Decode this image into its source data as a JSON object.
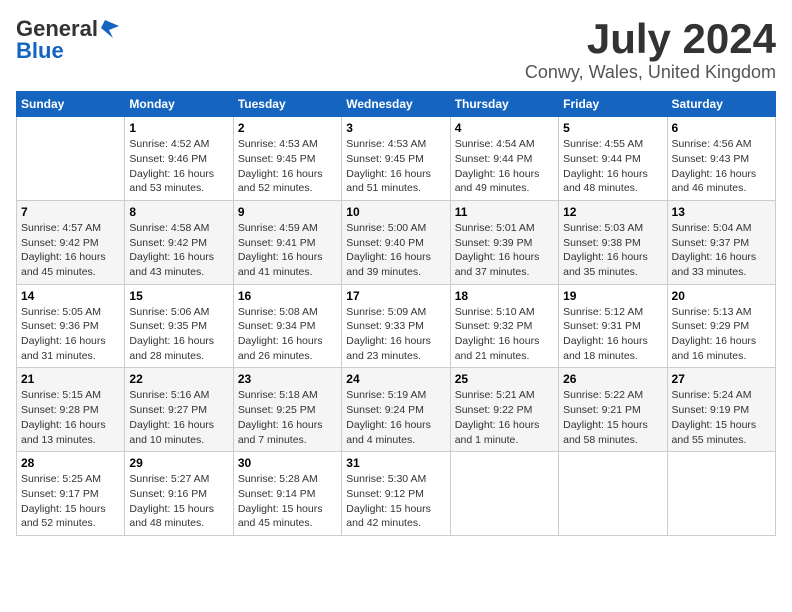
{
  "logo": {
    "general": "General",
    "blue": "Blue"
  },
  "title": {
    "month": "July 2024",
    "location": "Conwy, Wales, United Kingdom"
  },
  "weekdays": [
    "Sunday",
    "Monday",
    "Tuesday",
    "Wednesday",
    "Thursday",
    "Friday",
    "Saturday"
  ],
  "weeks": [
    [
      {
        "day": "",
        "content": ""
      },
      {
        "day": "1",
        "content": "Sunrise: 4:52 AM\nSunset: 9:46 PM\nDaylight: 16 hours\nand 53 minutes."
      },
      {
        "day": "2",
        "content": "Sunrise: 4:53 AM\nSunset: 9:45 PM\nDaylight: 16 hours\nand 52 minutes."
      },
      {
        "day": "3",
        "content": "Sunrise: 4:53 AM\nSunset: 9:45 PM\nDaylight: 16 hours\nand 51 minutes."
      },
      {
        "day": "4",
        "content": "Sunrise: 4:54 AM\nSunset: 9:44 PM\nDaylight: 16 hours\nand 49 minutes."
      },
      {
        "day": "5",
        "content": "Sunrise: 4:55 AM\nSunset: 9:44 PM\nDaylight: 16 hours\nand 48 minutes."
      },
      {
        "day": "6",
        "content": "Sunrise: 4:56 AM\nSunset: 9:43 PM\nDaylight: 16 hours\nand 46 minutes."
      }
    ],
    [
      {
        "day": "7",
        "content": "Sunrise: 4:57 AM\nSunset: 9:42 PM\nDaylight: 16 hours\nand 45 minutes."
      },
      {
        "day": "8",
        "content": "Sunrise: 4:58 AM\nSunset: 9:42 PM\nDaylight: 16 hours\nand 43 minutes."
      },
      {
        "day": "9",
        "content": "Sunrise: 4:59 AM\nSunset: 9:41 PM\nDaylight: 16 hours\nand 41 minutes."
      },
      {
        "day": "10",
        "content": "Sunrise: 5:00 AM\nSunset: 9:40 PM\nDaylight: 16 hours\nand 39 minutes."
      },
      {
        "day": "11",
        "content": "Sunrise: 5:01 AM\nSunset: 9:39 PM\nDaylight: 16 hours\nand 37 minutes."
      },
      {
        "day": "12",
        "content": "Sunrise: 5:03 AM\nSunset: 9:38 PM\nDaylight: 16 hours\nand 35 minutes."
      },
      {
        "day": "13",
        "content": "Sunrise: 5:04 AM\nSunset: 9:37 PM\nDaylight: 16 hours\nand 33 minutes."
      }
    ],
    [
      {
        "day": "14",
        "content": "Sunrise: 5:05 AM\nSunset: 9:36 PM\nDaylight: 16 hours\nand 31 minutes."
      },
      {
        "day": "15",
        "content": "Sunrise: 5:06 AM\nSunset: 9:35 PM\nDaylight: 16 hours\nand 28 minutes."
      },
      {
        "day": "16",
        "content": "Sunrise: 5:08 AM\nSunset: 9:34 PM\nDaylight: 16 hours\nand 26 minutes."
      },
      {
        "day": "17",
        "content": "Sunrise: 5:09 AM\nSunset: 9:33 PM\nDaylight: 16 hours\nand 23 minutes."
      },
      {
        "day": "18",
        "content": "Sunrise: 5:10 AM\nSunset: 9:32 PM\nDaylight: 16 hours\nand 21 minutes."
      },
      {
        "day": "19",
        "content": "Sunrise: 5:12 AM\nSunset: 9:31 PM\nDaylight: 16 hours\nand 18 minutes."
      },
      {
        "day": "20",
        "content": "Sunrise: 5:13 AM\nSunset: 9:29 PM\nDaylight: 16 hours\nand 16 minutes."
      }
    ],
    [
      {
        "day": "21",
        "content": "Sunrise: 5:15 AM\nSunset: 9:28 PM\nDaylight: 16 hours\nand 13 minutes."
      },
      {
        "day": "22",
        "content": "Sunrise: 5:16 AM\nSunset: 9:27 PM\nDaylight: 16 hours\nand 10 minutes."
      },
      {
        "day": "23",
        "content": "Sunrise: 5:18 AM\nSunset: 9:25 PM\nDaylight: 16 hours\nand 7 minutes."
      },
      {
        "day": "24",
        "content": "Sunrise: 5:19 AM\nSunset: 9:24 PM\nDaylight: 16 hours\nand 4 minutes."
      },
      {
        "day": "25",
        "content": "Sunrise: 5:21 AM\nSunset: 9:22 PM\nDaylight: 16 hours\nand 1 minute."
      },
      {
        "day": "26",
        "content": "Sunrise: 5:22 AM\nSunset: 9:21 PM\nDaylight: 15 hours\nand 58 minutes."
      },
      {
        "day": "27",
        "content": "Sunrise: 5:24 AM\nSunset: 9:19 PM\nDaylight: 15 hours\nand 55 minutes."
      }
    ],
    [
      {
        "day": "28",
        "content": "Sunrise: 5:25 AM\nSunset: 9:17 PM\nDaylight: 15 hours\nand 52 minutes."
      },
      {
        "day": "29",
        "content": "Sunrise: 5:27 AM\nSunset: 9:16 PM\nDaylight: 15 hours\nand 48 minutes."
      },
      {
        "day": "30",
        "content": "Sunrise: 5:28 AM\nSunset: 9:14 PM\nDaylight: 15 hours\nand 45 minutes."
      },
      {
        "day": "31",
        "content": "Sunrise: 5:30 AM\nSunset: 9:12 PM\nDaylight: 15 hours\nand 42 minutes."
      },
      {
        "day": "",
        "content": ""
      },
      {
        "day": "",
        "content": ""
      },
      {
        "day": "",
        "content": ""
      }
    ]
  ]
}
